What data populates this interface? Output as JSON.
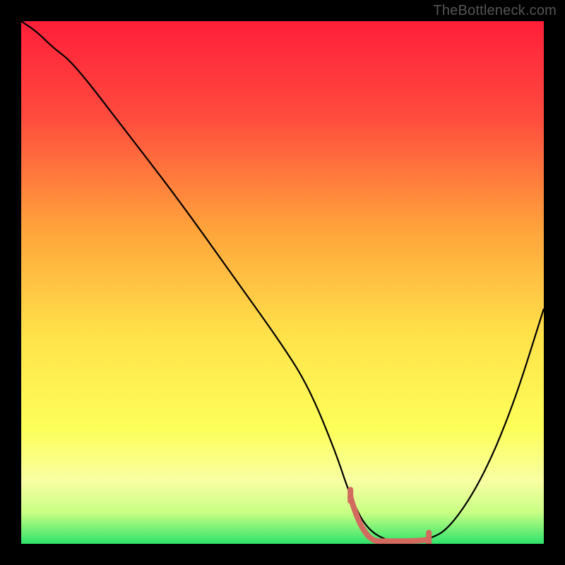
{
  "watermark": "TheBottleneck.com",
  "chart_data": {
    "type": "line",
    "title": "",
    "xlabel": "",
    "ylabel": "",
    "xlim": [
      0,
      100
    ],
    "ylim": [
      0,
      100
    ],
    "gradient_stops": [
      {
        "offset": 0,
        "color": "#ff1f3a"
      },
      {
        "offset": 18,
        "color": "#ff4a3e"
      },
      {
        "offset": 40,
        "color": "#ffa43b"
      },
      {
        "offset": 60,
        "color": "#ffe24a"
      },
      {
        "offset": 78,
        "color": "#fdff59"
      },
      {
        "offset": 88,
        "color": "#f8ffa3"
      },
      {
        "offset": 94,
        "color": "#c9ff84"
      },
      {
        "offset": 100,
        "color": "#2fe36b"
      }
    ],
    "series": [
      {
        "name": "bottleneck-curve",
        "x": [
          0,
          3,
          6,
          10,
          20,
          30,
          40,
          50,
          55,
          60,
          63,
          66,
          70,
          74,
          78,
          82,
          88,
          94,
          100
        ],
        "y": [
          100,
          98,
          95,
          92,
          79,
          66,
          52,
          38,
          30,
          18,
          9,
          3,
          0.5,
          0.5,
          0.8,
          3,
          12,
          26,
          45
        ]
      }
    ],
    "marker": {
      "name": "selected-range",
      "color": "#d36a60",
      "x_start": 63,
      "x_end": 78,
      "y_start_curve": 9,
      "y_end_curve": 0.8
    }
  }
}
